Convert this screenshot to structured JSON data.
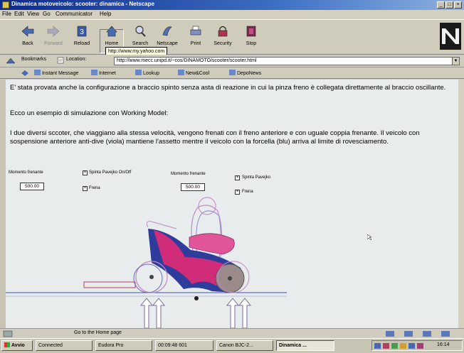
{
  "window": {
    "title": "Dinamica motoveicolo: scooter: dinamica - Netscape"
  },
  "menu": [
    "File",
    "Edit",
    "View",
    "Go",
    "Communicator",
    "Help"
  ],
  "toolbar": [
    {
      "label": "Back",
      "icon": "back-arrow-icon",
      "enabled": true
    },
    {
      "label": "Forward",
      "icon": "forward-arrow-icon",
      "enabled": false
    },
    {
      "label": "Reload",
      "icon": "reload-icon",
      "enabled": true
    },
    {
      "label": "Home",
      "icon": "home-icon",
      "enabled": true
    },
    {
      "label": "Search",
      "icon": "search-icon",
      "enabled": true
    },
    {
      "label": "Netscape",
      "icon": "netscape-icon",
      "enabled": true
    },
    {
      "label": "Print",
      "icon": "print-icon",
      "enabled": true
    },
    {
      "label": "Security",
      "icon": "security-icon",
      "enabled": true
    },
    {
      "label": "Stop",
      "icon": "stop-icon",
      "enabled": true
    }
  ],
  "tooltip": "http://www.my.yahoo.com",
  "location": {
    "bookmarks_label": "Bookmarks",
    "location_label": "Location:",
    "url": "http://www.mecc.unipd.it/~cos/DINAMOTO/scooter/scooter.html"
  },
  "personal_bar": [
    "Instant Message",
    "Internet",
    "Lookup",
    "New&Cool",
    "DepoNews"
  ],
  "content": {
    "para1": "E' stata provata anche la configurazione a braccio spinto senza asta di reazione in cui la pinza freno è collegata direttamente al braccio oscillante.",
    "para2": "Ecco un esempio di simulazione con Working Model:",
    "para3": "I due diversi sccoter, che viaggiano alla stessa velocità, vengono frenati con il freno anteriore e con uguale coppia frenante. Il veicolo con sospensione anteriore anti-dive (viola) mantiene l'assetto mentre il veicolo con la forcella (blu) arriva al limite di rovesciamento."
  },
  "simulation": {
    "left": {
      "moment_label": "Momento frenante",
      "moment_value": "500.00",
      "checkbox1": "Spinta Pavejko On/Off",
      "checkbox2": "Frena"
    },
    "right": {
      "moment_label": "Momento frenante",
      "moment_value": "500.00",
      "checkbox1": "Spinta Pavejko",
      "checkbox2": "Frena"
    },
    "colors": {
      "antidive": "#d02c7a",
      "fork": "#2e3c9c",
      "ground": "#3a4cc0"
    }
  },
  "status": {
    "text": "Go to the Home page"
  },
  "taskbar": {
    "start": "Avvio",
    "tasks": [
      "Connected",
      "Eudora Pro",
      "00:09:48 601",
      "Canon BJC-2...",
      "Dinamica ..."
    ],
    "clock": "16:14"
  }
}
